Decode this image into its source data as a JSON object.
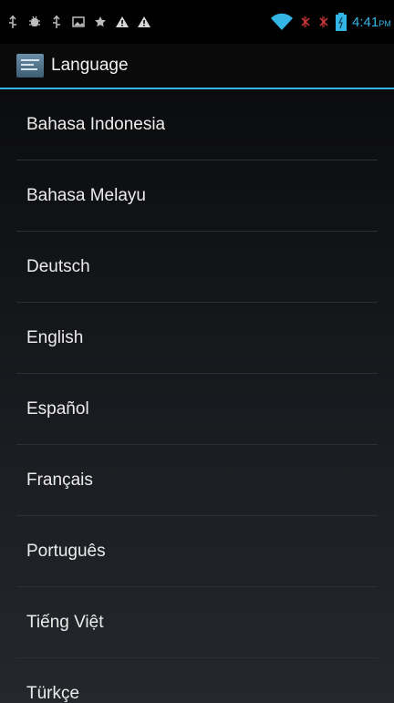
{
  "status_bar": {
    "time": "4:41",
    "ampm": "PM",
    "left_icons": [
      "usb-icon",
      "debug-icon",
      "usb-icon",
      "image-icon",
      "star-icon",
      "warning-icon",
      "warning-icon"
    ],
    "right_icons": [
      "wifi-icon",
      "no-signal-icon",
      "no-signal-icon",
      "battery-icon"
    ]
  },
  "action_bar": {
    "title": "Language",
    "icon": "settings-app-icon"
  },
  "colors": {
    "accent": "#33b5e5",
    "background": "#000000"
  },
  "languages": [
    {
      "label": "Bahasa Indonesia"
    },
    {
      "label": "Bahasa Melayu"
    },
    {
      "label": "Deutsch"
    },
    {
      "label": "English"
    },
    {
      "label": "Español"
    },
    {
      "label": "Français"
    },
    {
      "label": "Português"
    },
    {
      "label": "Tiếng Việt"
    },
    {
      "label": "Türkçe"
    }
  ]
}
